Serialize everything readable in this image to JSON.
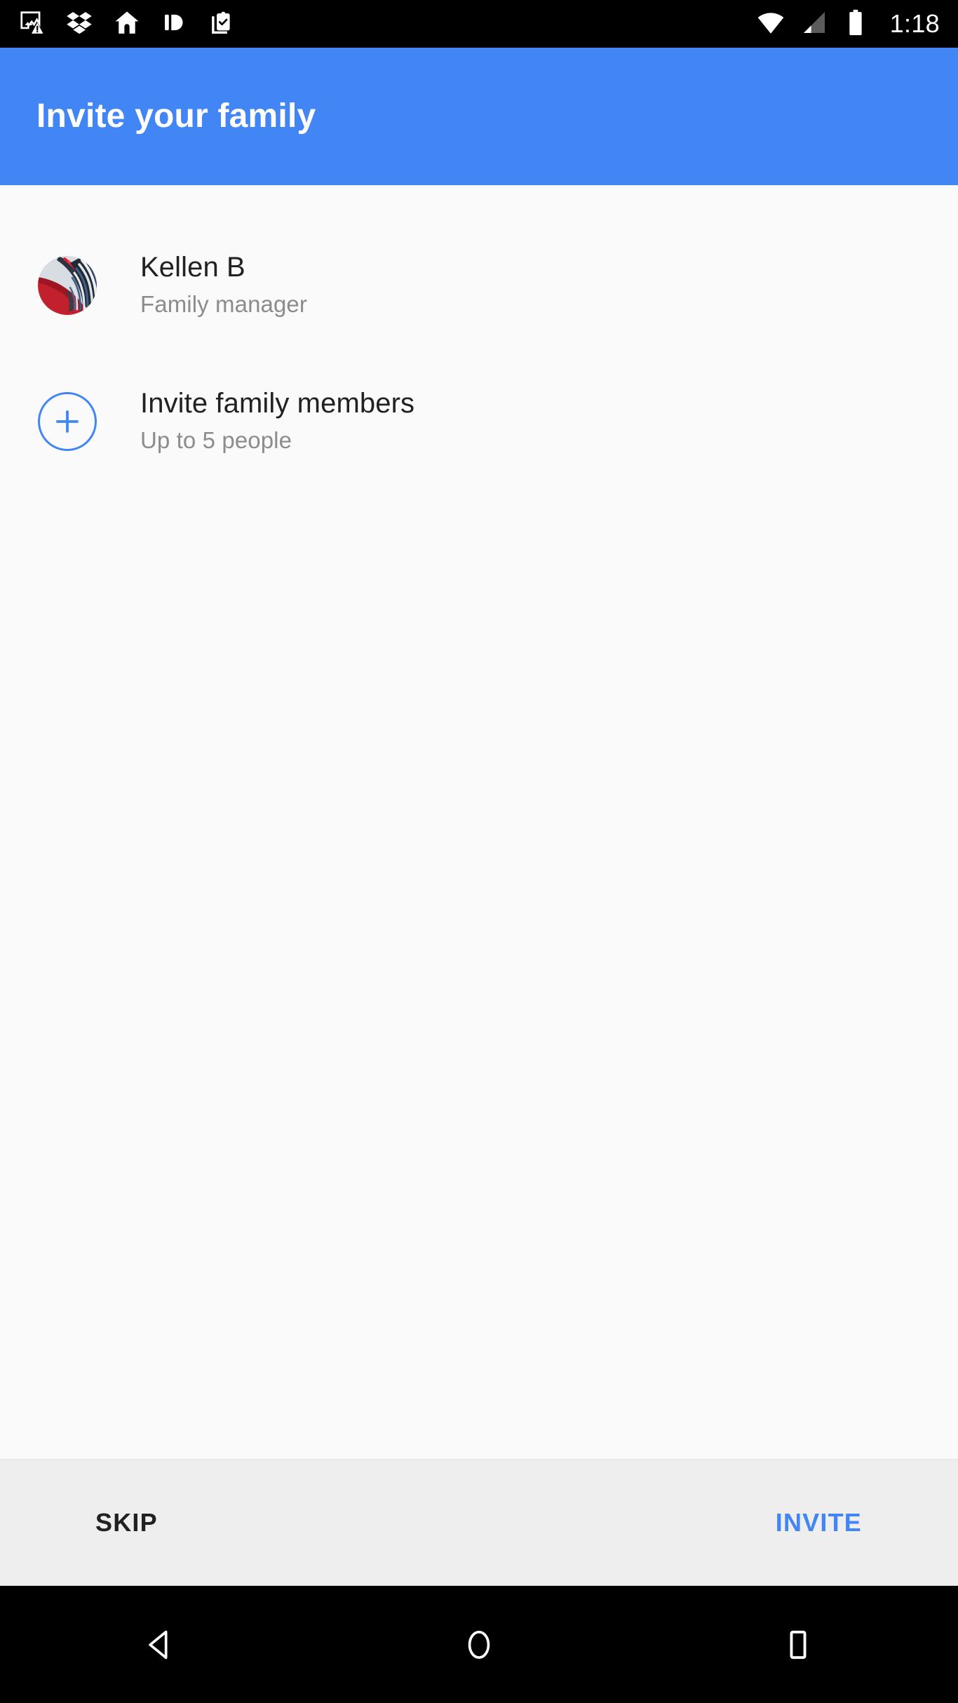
{
  "status_bar": {
    "left_icons": [
      {
        "name": "image-warning-icon",
        "label": "Screenshot capture failed"
      },
      {
        "name": "dropbox-icon",
        "label": "Dropbox"
      },
      {
        "name": "home-icon",
        "label": "Home"
      },
      {
        "name": "split-panel-icon",
        "label": "Split panel"
      },
      {
        "name": "clipboard-check-icon",
        "label": "Clipboard task"
      }
    ],
    "right_icons": [
      {
        "name": "wifi-icon",
        "label": "Wi-Fi connected"
      },
      {
        "name": "cell-signal-icon",
        "label": "Mobile signal"
      },
      {
        "name": "battery-icon",
        "label": "Battery"
      }
    ],
    "time": "1:18",
    "background": "#000000",
    "foreground": "#FFFFFF"
  },
  "app_bar": {
    "title": "Invite your family",
    "background": "#4285F4",
    "text_color": "#FFFFFF"
  },
  "content": {
    "background": "#FAFAFA",
    "rows": [
      {
        "id": "family-manager",
        "leading": "avatar-photo",
        "title": "Kellen B",
        "subtitle": "Family manager"
      },
      {
        "id": "invite-family-members",
        "leading": "plus-circle-icon",
        "title": "Invite family members",
        "subtitle": "Up to 5 people"
      }
    ],
    "title_color": "#212121",
    "subtitle_color": "#8C8C8C",
    "accent_color": "#4285F4"
  },
  "bottom_bar": {
    "background": "#EEEEEE",
    "skip_label": "SKIP",
    "skip_color": "#212121",
    "invite_label": "INVITE",
    "invite_color": "#4285F4"
  },
  "nav_bar": {
    "background": "#000000",
    "buttons": [
      {
        "name": "back-button",
        "label": "Back"
      },
      {
        "name": "home-button",
        "label": "Home"
      },
      {
        "name": "recents-button",
        "label": "Recent apps"
      }
    ]
  }
}
